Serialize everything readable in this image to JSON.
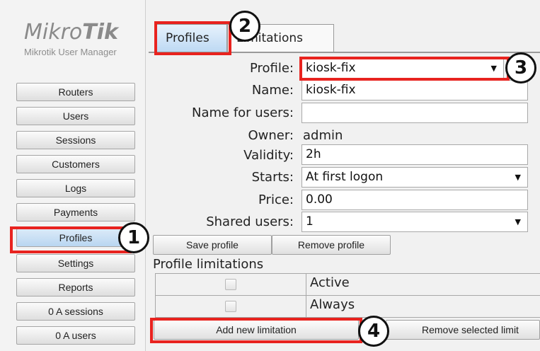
{
  "branding": {
    "logo_mikro": "Mikro",
    "logo_tik": "Tik",
    "subtitle": "Mikrotik User Manager"
  },
  "sidebar": {
    "items": [
      {
        "label": "Routers"
      },
      {
        "label": "Users"
      },
      {
        "label": "Sessions"
      },
      {
        "label": "Customers"
      },
      {
        "label": "Logs"
      },
      {
        "label": "Payments"
      },
      {
        "label": "Profiles",
        "active": true
      },
      {
        "label": "Settings"
      },
      {
        "label": "Reports"
      },
      {
        "label": "0 A sessions"
      },
      {
        "label": "0 A users"
      }
    ]
  },
  "tabs": [
    {
      "label": "Profiles",
      "active": true
    },
    {
      "label": "Limitations"
    }
  ],
  "form": {
    "profile": {
      "label": "Profile:",
      "value": "kiosk-fix"
    },
    "name": {
      "label": "Name:",
      "value": "kiosk-fix"
    },
    "name_for_users": {
      "label": "Name for users:",
      "value": ""
    },
    "owner": {
      "label": "Owner:",
      "value": "admin"
    },
    "validity": {
      "label": "Validity:",
      "value": "2h"
    },
    "starts": {
      "label": "Starts:",
      "value": "At first logon"
    },
    "price": {
      "label": "Price:",
      "value": "0.00"
    },
    "shared_users": {
      "label": "Shared users:",
      "value": "1"
    }
  },
  "buttons": {
    "save_profile": "Save profile",
    "remove_profile": "Remove profile",
    "add_limitation": "Add new limitation",
    "remove_selected": "Remove selected limit"
  },
  "limitations": {
    "title": "Profile limitations",
    "rows": [
      {
        "label": "Active"
      },
      {
        "label": "Always"
      }
    ]
  },
  "callouts": [
    "1",
    "2",
    "3",
    "4"
  ],
  "colors": {
    "highlight": "#e8231f",
    "active_button": "#c6def4"
  },
  "icons": {
    "dropdown": "triangle-down-icon",
    "checkbox": "checkbox-icon"
  }
}
